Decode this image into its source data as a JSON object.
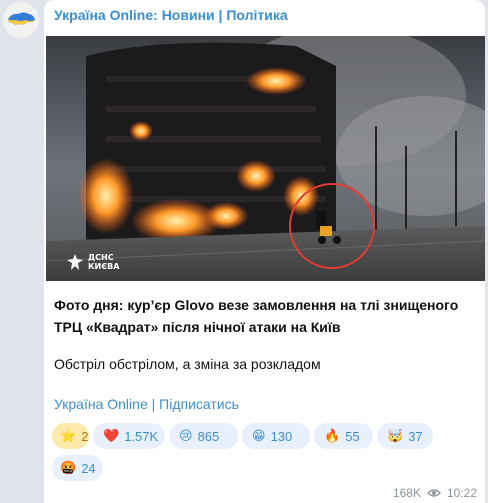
{
  "channel": {
    "title": "Україна Online: Новини | Політика",
    "accent_color": "#3a8fd1"
  },
  "photo": {
    "credit_line1": "ДСНС",
    "credit_line2": "КИЄВА"
  },
  "post": {
    "text_bold": "Фото дня: кур’єр Glovo везе замовлення на тлі знищеного ТРЦ «Квадрат» після нічної атаки на Київ",
    "text_normal": "Обстріл обстрілом, а зміна за розкладом",
    "footer_link": "Україна Online | Підписатись"
  },
  "reactions": [
    {
      "emoji": "star-icon",
      "glyph": "⭐",
      "count": "2"
    },
    {
      "emoji": "heart-icon",
      "glyph": "❤️",
      "count": "1.57K"
    },
    {
      "emoji": "crying-face-icon",
      "glyph": "😢",
      "count": "865"
    },
    {
      "emoji": "grinning-face-icon",
      "glyph": "😁",
      "count": "130"
    },
    {
      "emoji": "fire-icon",
      "glyph": "🔥",
      "count": "55"
    },
    {
      "emoji": "exploding-head-icon",
      "glyph": "🤯",
      "count": "37"
    },
    {
      "emoji": "angry-face-icon",
      "glyph": "🤬",
      "count": "24"
    }
  ],
  "meta": {
    "views": "168K",
    "time": "10:22"
  }
}
